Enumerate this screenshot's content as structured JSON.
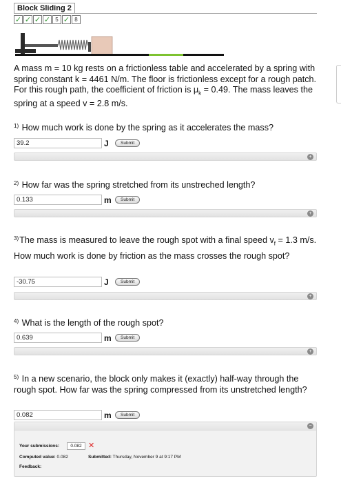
{
  "header": {
    "title": "Block Sliding 2",
    "progress": [
      {
        "label": "✓",
        "done": true
      },
      {
        "label": "✓",
        "done": true
      },
      {
        "label": "✓",
        "done": true
      },
      {
        "label": "✓",
        "done": true
      },
      {
        "label": "5",
        "done": false
      },
      {
        "label": "✓",
        "done": true
      },
      {
        "label": "8",
        "done": false
      }
    ]
  },
  "intro": {
    "p1": "A mass m = 10 kg rests on a frictionless table and accelerated by a spring with spring constant k = 4461 N/m. The floor is frictionless except for a rough patch. For this rough path, the coefficient of friction is μ",
    "mu_sub": "k",
    "p2": " = 0.49. The mass leaves the spring at a speed v = 2.8 m/s."
  },
  "questions": [
    {
      "num": "1)",
      "text": "How much work is done by the spring as it accelerates the mass?",
      "value": "39.2",
      "unit": "J",
      "submit": "Submit"
    },
    {
      "num": "2)",
      "text": "How far was the spring stretched from its unstreched length?",
      "value": "0.133",
      "unit": "m",
      "submit": "Submit"
    },
    {
      "num": "3)",
      "text_a": "The mass is measured to leave the rough spot with a final speed v",
      "sub": "f",
      "text_b": " = 1.3 m/s.",
      "text_c": "How much work is done by friction as the mass crosses the rough spot?",
      "value": "-30.75",
      "unit": "J",
      "submit": "Submit"
    },
    {
      "num": "4)",
      "text": "What is the length of the rough spot?",
      "value": "0.639",
      "unit": "m",
      "submit": "Submit"
    },
    {
      "num": "5)",
      "text": "In a new scenario, the block only makes it (exactly) half-way through the rough spot. How far was the spring compressed from its unstretched length?",
      "value": "0.082",
      "unit": "m",
      "submit": "Submit"
    }
  ],
  "feedback": {
    "submissions_label": "Your submissions:",
    "submission_value": "0.082",
    "computed_label": "Computed value:",
    "computed_value": "0.082",
    "submitted_label": "Submitted:",
    "submitted_value": "Thursday, November 9 at 9:17 PM",
    "feedback_label": "Feedback:"
  },
  "icons": {
    "expand": "expand-icon",
    "collapse": "collapse-icon",
    "wrong": "x-icon"
  },
  "colors": {
    "check": "#3a9a3a",
    "rough_patch": "#7dc230",
    "block": "#e8c9b8",
    "wrong": "#dd2222"
  }
}
